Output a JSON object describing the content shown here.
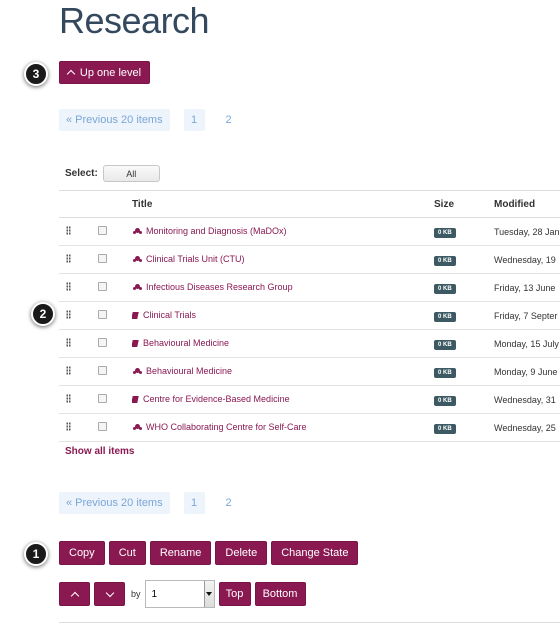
{
  "page": {
    "title": "Research"
  },
  "nav": {
    "up_label": "Up one level"
  },
  "callouts": [
    "1",
    "2",
    "3"
  ],
  "pagination": {
    "prev_label": "« Previous 20 items",
    "pages": [
      "1",
      "2"
    ]
  },
  "select": {
    "label": "Select:",
    "all_label": "All"
  },
  "table": {
    "columns": {
      "title": "Title",
      "size": "Size",
      "modified": "Modified"
    },
    "rows": [
      {
        "icon": "group-icon",
        "title": "Monitoring and Diagnosis (MaDOx)",
        "size": "0 KB",
        "modified": "Tuesday, 28 Jan"
      },
      {
        "icon": "group-icon",
        "title": "Clinical Trials Unit (CTU)",
        "size": "0 KB",
        "modified": "Wednesday, 19"
      },
      {
        "icon": "group-icon",
        "title": "Infectious Diseases Research Group",
        "size": "0 KB",
        "modified": "Friday, 13 June"
      },
      {
        "icon": "book-icon",
        "title": "Clinical Trials",
        "size": "0 KB",
        "modified": "Friday, 7 Septer"
      },
      {
        "icon": "book-icon",
        "title": "Behavioural Medicine",
        "size": "0 KB",
        "modified": "Monday, 15 July"
      },
      {
        "icon": "group-icon",
        "title": "Behavioural Medicine",
        "size": "0 KB",
        "modified": "Monday, 9 June"
      },
      {
        "icon": "book-icon",
        "title": "Centre for Evidence-Based Medicine",
        "size": "0 KB",
        "modified": "Wednesday, 31"
      },
      {
        "icon": "group-icon",
        "title": "WHO Collaborating Centre for Self-Care",
        "size": "0 KB",
        "modified": "Wednesday, 25"
      }
    ],
    "show_all_label": "Show all items"
  },
  "actions": {
    "copy": "Copy",
    "cut": "Cut",
    "rename": "Rename",
    "delete": "Delete",
    "change_state": "Change State"
  },
  "ordering": {
    "by_label": "by",
    "by_value": "1",
    "top_label": "Top",
    "bottom_label": "Bottom"
  },
  "colors": {
    "accent": "#8a1952",
    "title": "#34495e",
    "pager": "#7aa6d6",
    "size_badge": "#3d5a64"
  }
}
